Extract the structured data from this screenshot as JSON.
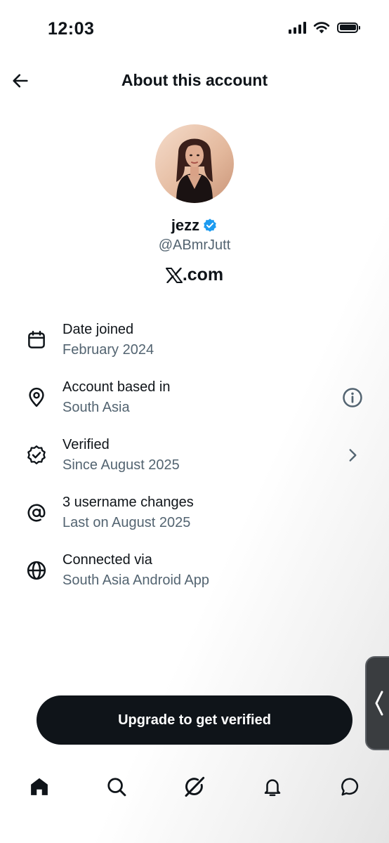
{
  "status_bar": {
    "time": "12:03"
  },
  "header": {
    "title": "About this account"
  },
  "profile": {
    "display_name": "jezz",
    "handle": "@ABmrJutt",
    "domain_label": ".com",
    "verified": true
  },
  "info_items": [
    {
      "icon": "calendar-icon",
      "title": "Date joined",
      "subtitle": "February 2024"
    },
    {
      "icon": "location-pin-icon",
      "title": "Account based in",
      "subtitle": "South Asia",
      "action": "info-icon"
    },
    {
      "icon": "verified-badge-icon",
      "title": "Verified",
      "subtitle": "Since August 2025",
      "action": "chevron-right-icon"
    },
    {
      "icon": "at-icon",
      "title": "3 username changes",
      "subtitle": "Last on August 2025"
    },
    {
      "icon": "globe-icon",
      "title": "Connected via",
      "subtitle": "South Asia Android App"
    }
  ],
  "upgrade_button": {
    "label": "Upgrade to get verified"
  },
  "bottom_nav": [
    "home-icon",
    "search-icon",
    "grok-icon",
    "notifications-icon",
    "messages-icon"
  ],
  "colors": {
    "text_primary": "#0f1419",
    "text_secondary": "#536471",
    "verified_blue": "#1d9bf0",
    "button_bg": "#0f1419"
  }
}
